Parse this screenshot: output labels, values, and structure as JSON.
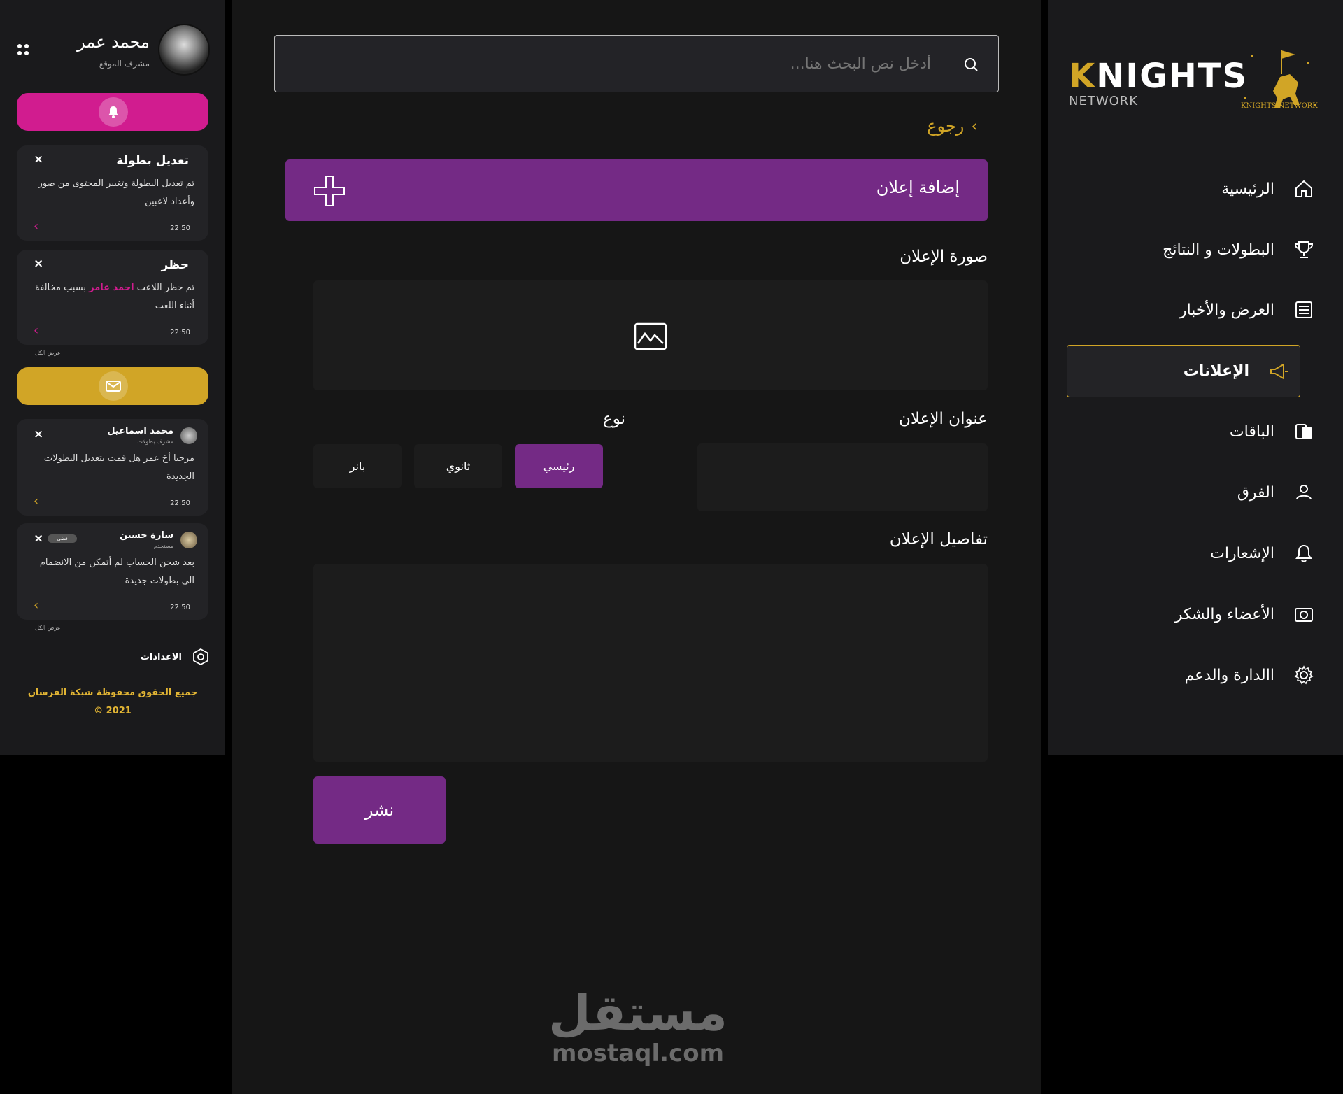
{
  "user": {
    "name": "محمد عمر",
    "role": "مشرف الموقع"
  },
  "notifications_title_icon": "bell-icon",
  "notifications": [
    {
      "title": "تعديل بطولة",
      "body": "تم تعديل البطولة وتغيير المحتوى من صور وأعداد لاعبين",
      "time": "22:50"
    },
    {
      "title": "حظر",
      "body_before": "تم حظر اللاعب ",
      "body_highlight": "احمد عامر",
      "body_after": " بسبب مخالفة أثناء اللعب",
      "time": "22:50"
    }
  ],
  "notifications_show_all": "عرض الكل",
  "messages": [
    {
      "name": "محمد اسماعيل",
      "role": "مشرف بطولات",
      "body": "مرحبا أخ عمر هل قمت بتعديل البطولات الجديدة",
      "time": "22:50"
    },
    {
      "name": "سارة حسين",
      "role": "مستخدم",
      "badge": "فضي",
      "body": "بعد شحن الحساب لم أتمكن من الانضمام الى بطولات جديدة",
      "time": "22:50"
    }
  ],
  "messages_show_all": "عرض الكل",
  "settings_label": "الاعدادات",
  "footer": {
    "line1": "جميع الحقوق محفوظة شبكة الفرسان",
    "line2": "© 2021"
  },
  "search": {
    "placeholder": "أدخل نص البحث هنا..."
  },
  "back_label": "رجوع",
  "page_header": "إضافة إعلان",
  "form": {
    "image_label": "صورة الإعلان",
    "title_label": "عنوان الإعلان",
    "type_label": "نوع",
    "types": [
      "رئيسي",
      "ثانوي",
      "بانر"
    ],
    "selected_type": "رئيسي",
    "details_label": "تفاصيل الإعلان",
    "publish_label": "نشر"
  },
  "brand": {
    "name_first": "K",
    "name_rest": "NIGHTS",
    "sub": "NETWORK",
    "emblem": "KNIGHTS NETWORK"
  },
  "nav": [
    {
      "label": "الرئيسية",
      "icon": "home-icon"
    },
    {
      "label": "البطولات و النتائج",
      "icon": "trophy-icon"
    },
    {
      "label": "العرض والأخبار",
      "icon": "newspaper-icon"
    },
    {
      "label": "الإعلانات",
      "icon": "megaphone-icon",
      "active": true
    },
    {
      "label": "الباقات",
      "icon": "cards-icon"
    },
    {
      "label": "الفرق",
      "icon": "team-icon"
    },
    {
      "label": "الإشعارات",
      "icon": "bell-icon"
    },
    {
      "label": "الأعضاء والشكر",
      "icon": "members-icon"
    },
    {
      "label": "االدارة والدعم",
      "icon": "gear-icon"
    }
  ],
  "watermark": {
    "arabic": "مستقل",
    "latin": "mostaql.com"
  },
  "colors": {
    "purple": "#742a85",
    "pink": "#d11c8f",
    "gold": "#d1a526",
    "accent_gold": "#e2b534"
  }
}
